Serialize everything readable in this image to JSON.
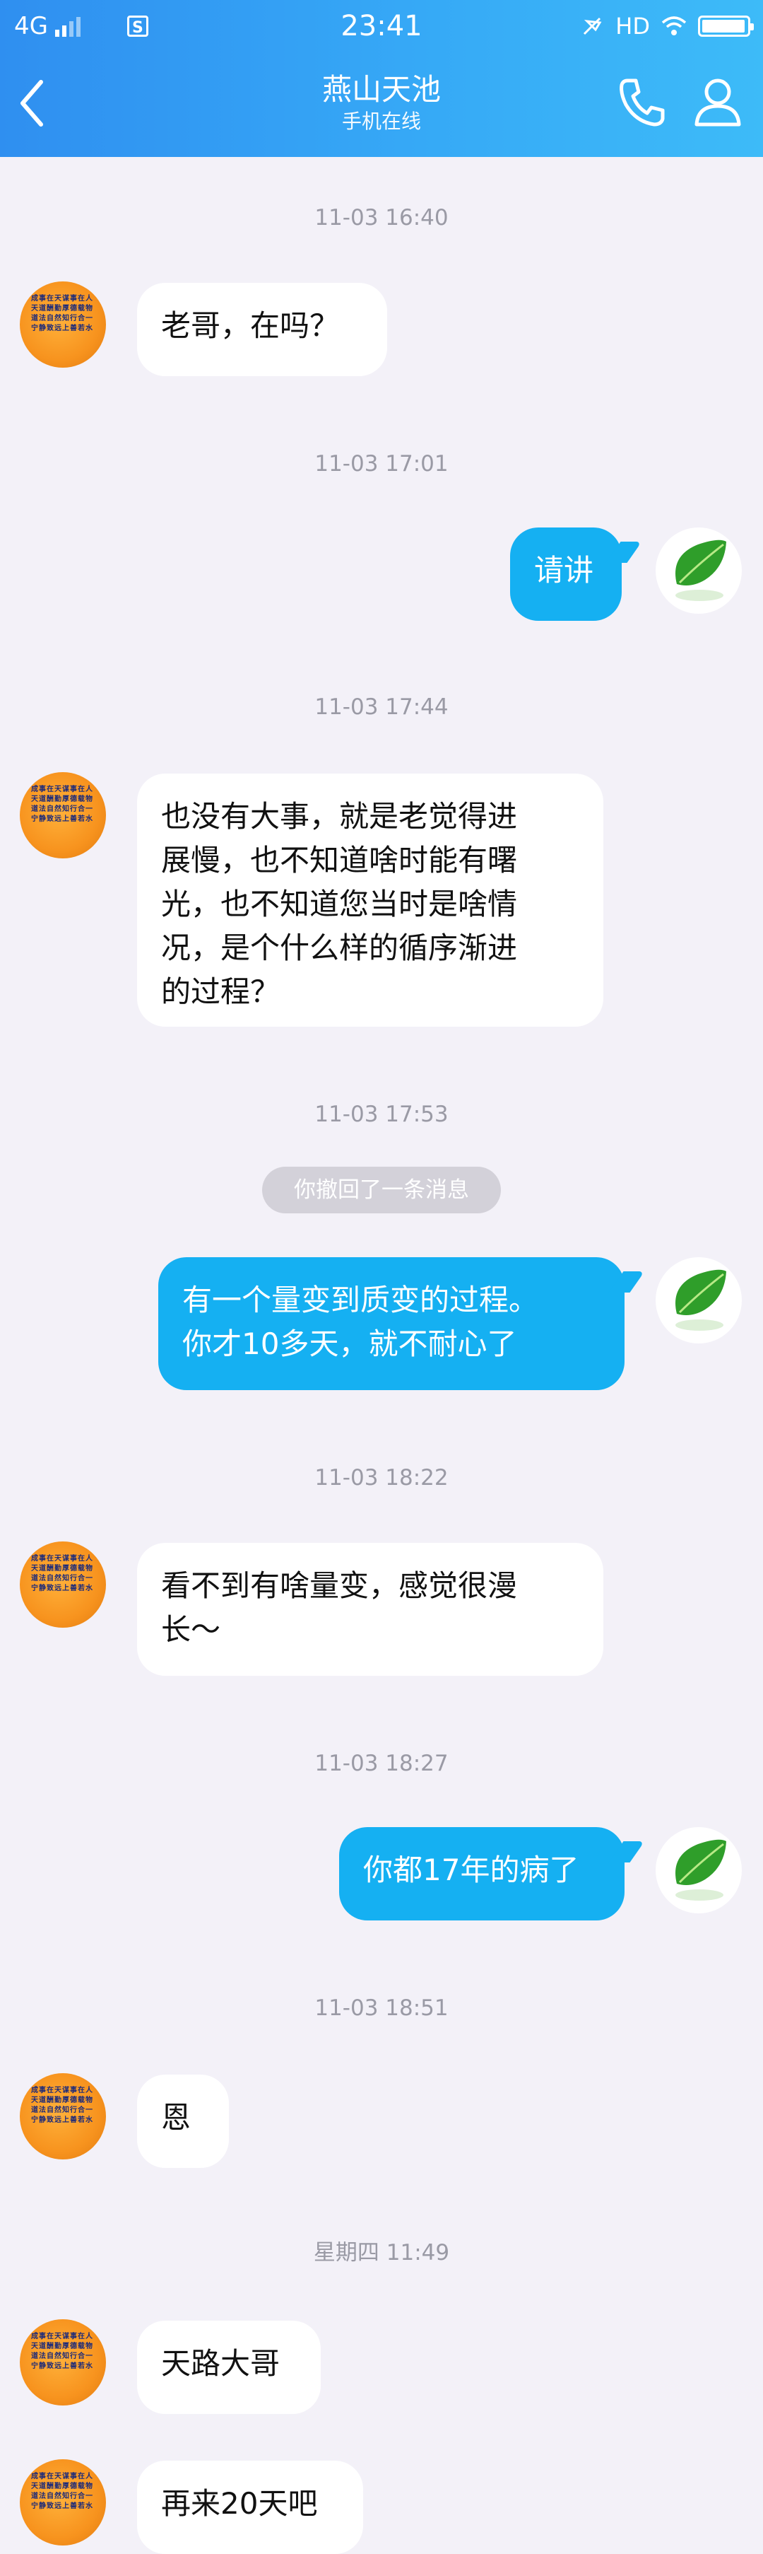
{
  "status_bar": {
    "network": "4G",
    "time": "23:41",
    "hd": "HD"
  },
  "header": {
    "title": "燕山天池",
    "subtitle": "手机在线"
  },
  "messages": [
    {
      "timestamp": "11-03 16:40",
      "side": "in",
      "text": "老哥，在吗？"
    },
    {
      "timestamp": "11-03 17:01",
      "side": "out",
      "text": "请讲"
    },
    {
      "timestamp": "11-03 17:44",
      "side": "in",
      "lines": [
        "也没有大事，就是老觉得进",
        "展慢，也不知道啥时能有曙",
        "光，也不知道您当时是啥情",
        "况，是个什么样的循序渐进",
        "的过程？"
      ]
    },
    {
      "timestamp": "11-03 17:53",
      "recall_notice": "你撤回了一条消息",
      "side": "out",
      "lines": [
        "有一个量变到质变的过程。",
        "你才10多天，就不耐心了"
      ]
    },
    {
      "timestamp": "11-03 18:22",
      "side": "in",
      "lines": [
        "看不到有啥量变，感觉很漫",
        "长～"
      ]
    },
    {
      "timestamp": "11-03 18:27",
      "side": "out",
      "text": "你都17年的病了"
    },
    {
      "timestamp": "11-03 18:51",
      "side": "in",
      "text": "恩"
    },
    {
      "timestamp": "星期四 11:49",
      "side": "in",
      "text": "天路大哥"
    },
    {
      "side": "in",
      "text": "再来20天吧"
    }
  ],
  "colors": {
    "header_start": "#2f8ff0",
    "header_end": "#3dbbf8",
    "background": "#f3f1f8",
    "outgoing_bubble": "#15b0f2",
    "incoming_bubble": "#ffffff",
    "timestamp": "#9a9aa5"
  },
  "icons": [
    "back-icon",
    "phone-icon",
    "person-icon",
    "signal-icon",
    "wifi-icon",
    "battery-icon",
    "silent-icon"
  ]
}
